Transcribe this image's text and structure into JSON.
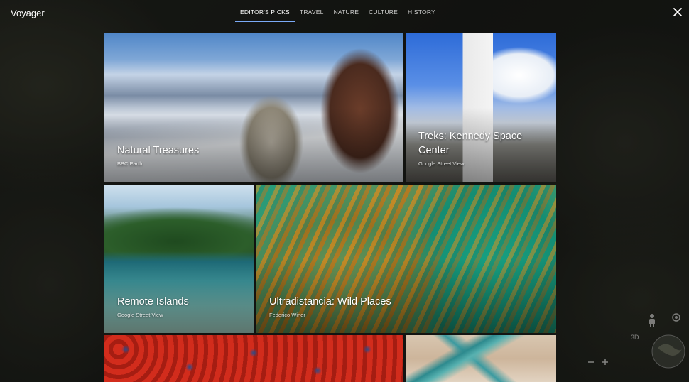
{
  "app": {
    "title": "Voyager"
  },
  "tabs": [
    {
      "label": "EDITOR'S PICKS",
      "active": true
    },
    {
      "label": "TRAVEL",
      "active": false
    },
    {
      "label": "NATURE",
      "active": false
    },
    {
      "label": "CULTURE",
      "active": false
    },
    {
      "label": "HISTORY",
      "active": false
    }
  ],
  "cards": [
    {
      "title": "Natural Treasures",
      "subtitle": "BBC Earth"
    },
    {
      "title": "Treks: Kennedy Space Center",
      "subtitle": "Google Street View"
    },
    {
      "title": "Remote Islands",
      "subtitle": "Google Street View"
    },
    {
      "title": "Ultradistancia: Wild Places",
      "subtitle": "Federico Winer"
    },
    {
      "title": "",
      "subtitle": ""
    },
    {
      "title": "",
      "subtitle": ""
    }
  ],
  "map_controls": {
    "view_3d_label": "3D"
  },
  "icons": {
    "close": "close-icon",
    "pegman": "pegman-icon",
    "locate": "my-location-icon",
    "zoom_out": "minus-icon",
    "zoom_in": "plus-icon",
    "globe": "globe-icon"
  },
  "colors": {
    "tab_indicator": "#7baaf7",
    "text": "#ffffff"
  }
}
